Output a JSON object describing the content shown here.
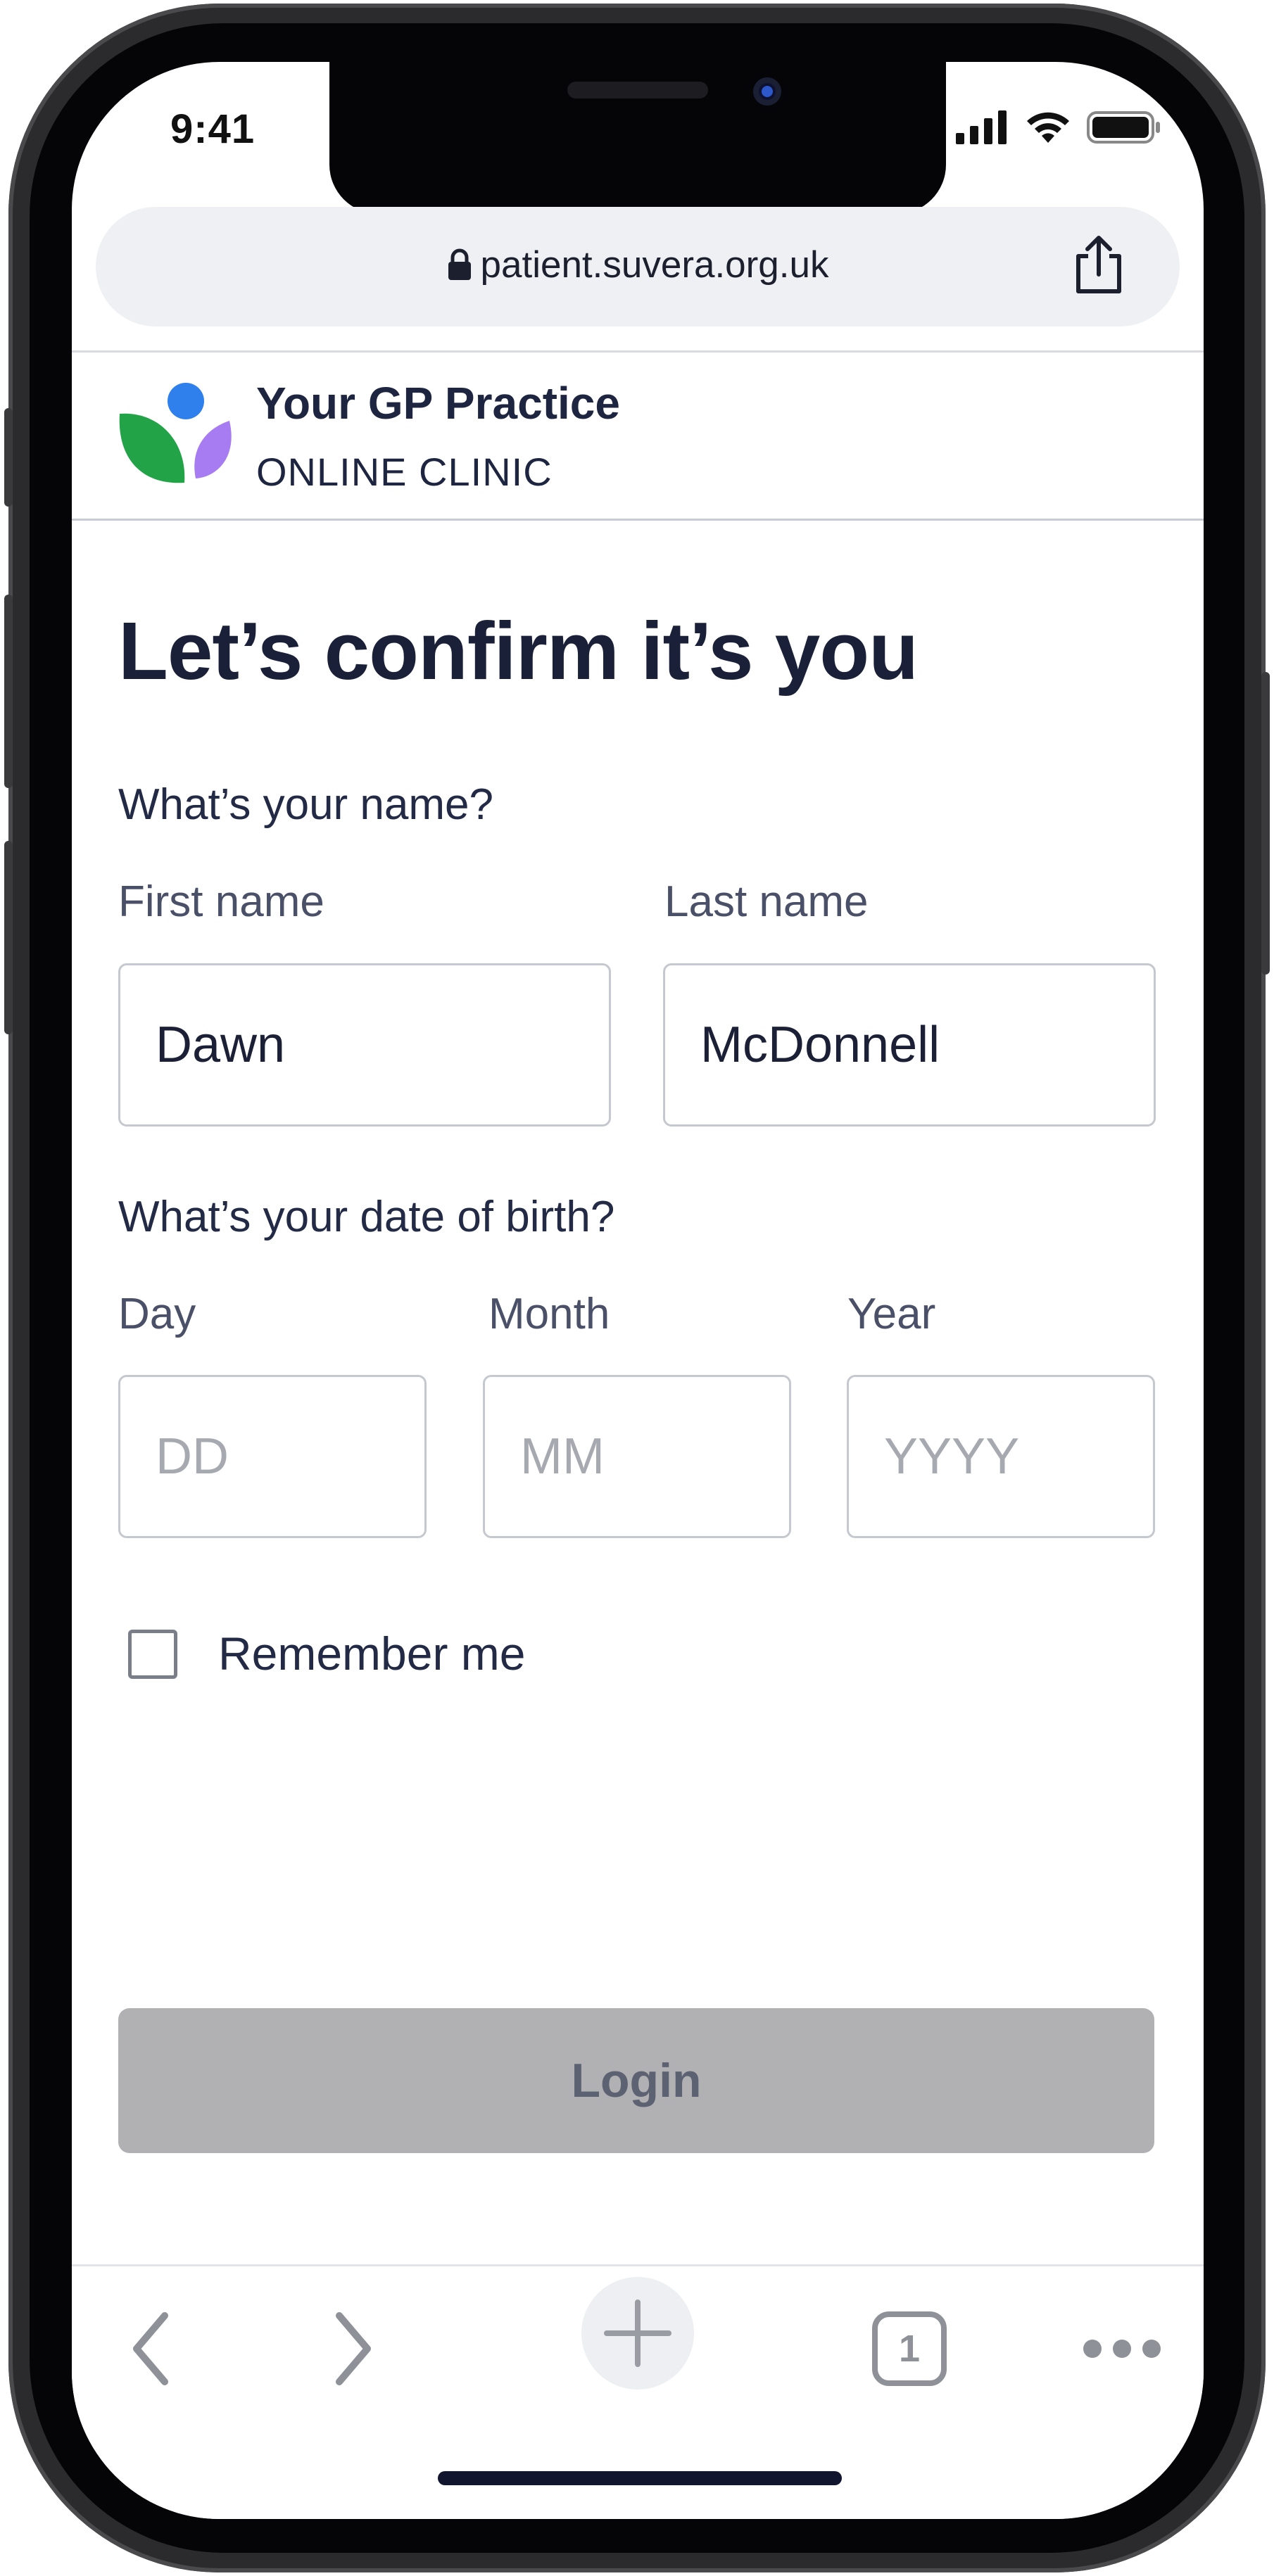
{
  "status_bar": {
    "time": "9:41"
  },
  "browser": {
    "url": "patient.suvera.org.uk",
    "toolbar": {
      "tab_count": "1"
    }
  },
  "site": {
    "title": "Your GP Practice",
    "subtitle": "ONLINE CLINIC",
    "logo_colors": {
      "blue": "#2f80ed",
      "green": "#22a347",
      "purple": "#a77cf2"
    }
  },
  "form": {
    "heading": "Let’s confirm it’s you",
    "name_question": "What’s your name?",
    "first_name": {
      "label": "First name",
      "value": "Dawn"
    },
    "last_name": {
      "label": "Last name",
      "value": "McDonnell"
    },
    "dob_question": "What’s your date of birth?",
    "day": {
      "label": "Day",
      "placeholder": "DD"
    },
    "month": {
      "label": "Month",
      "placeholder": "MM"
    },
    "year": {
      "label": "Year",
      "placeholder": "YYYY"
    },
    "remember_me": {
      "label": "Remember me",
      "checked": false
    },
    "login_label": "Login"
  },
  "icons": {
    "status": [
      "signal-icon",
      "wifi-icon",
      "battery-icon"
    ],
    "urlbar": [
      "lock-icon",
      "share-icon"
    ],
    "toolbar": [
      "back-icon",
      "forward-icon",
      "new-tab-icon",
      "tabs-icon",
      "more-icon"
    ]
  }
}
